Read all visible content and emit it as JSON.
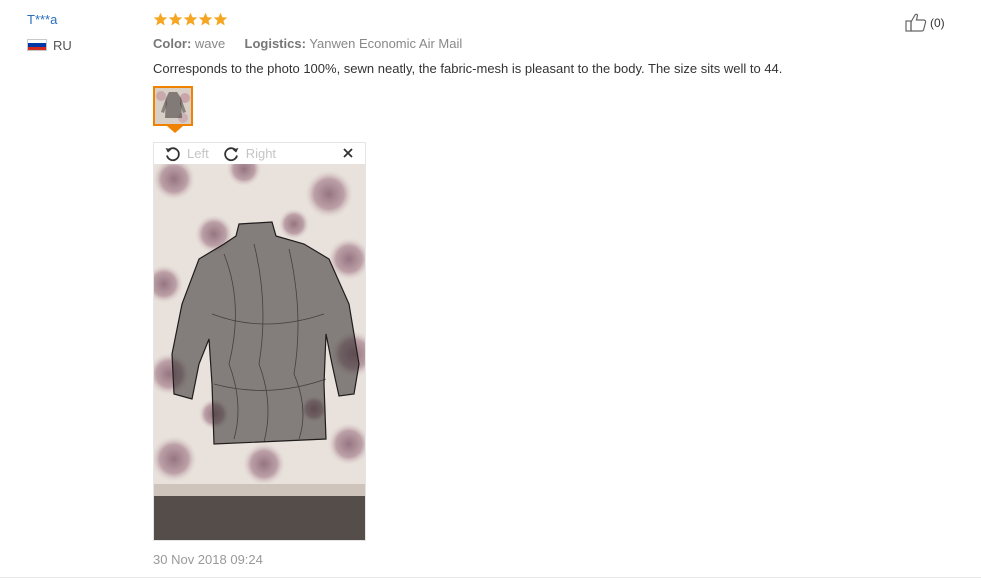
{
  "reviewer": {
    "name": "T***a",
    "country_code": "RU",
    "flag_colors": [
      "#ffffff",
      "#0039a6",
      "#d52b1e"
    ]
  },
  "review": {
    "rating": 5,
    "rating_color": "#f5a623",
    "color_label": "Color:",
    "color_value": "wave",
    "logistics_label": "Logistics:",
    "logistics_value": "Yanwen Economic Air Mail",
    "text": "Corresponds to the photo 100%, sewn neatly, the fabric-mesh is pleasant to the body. The size sits well to 44.",
    "date": "30 Nov 2018 09:24"
  },
  "helpful": {
    "count": "(0)",
    "icon": "thumbs-up-icon"
  },
  "viewer": {
    "rotate_left_label": "Left",
    "rotate_right_label": "Right",
    "close_icon": "close-icon",
    "accent": "#f08200"
  }
}
